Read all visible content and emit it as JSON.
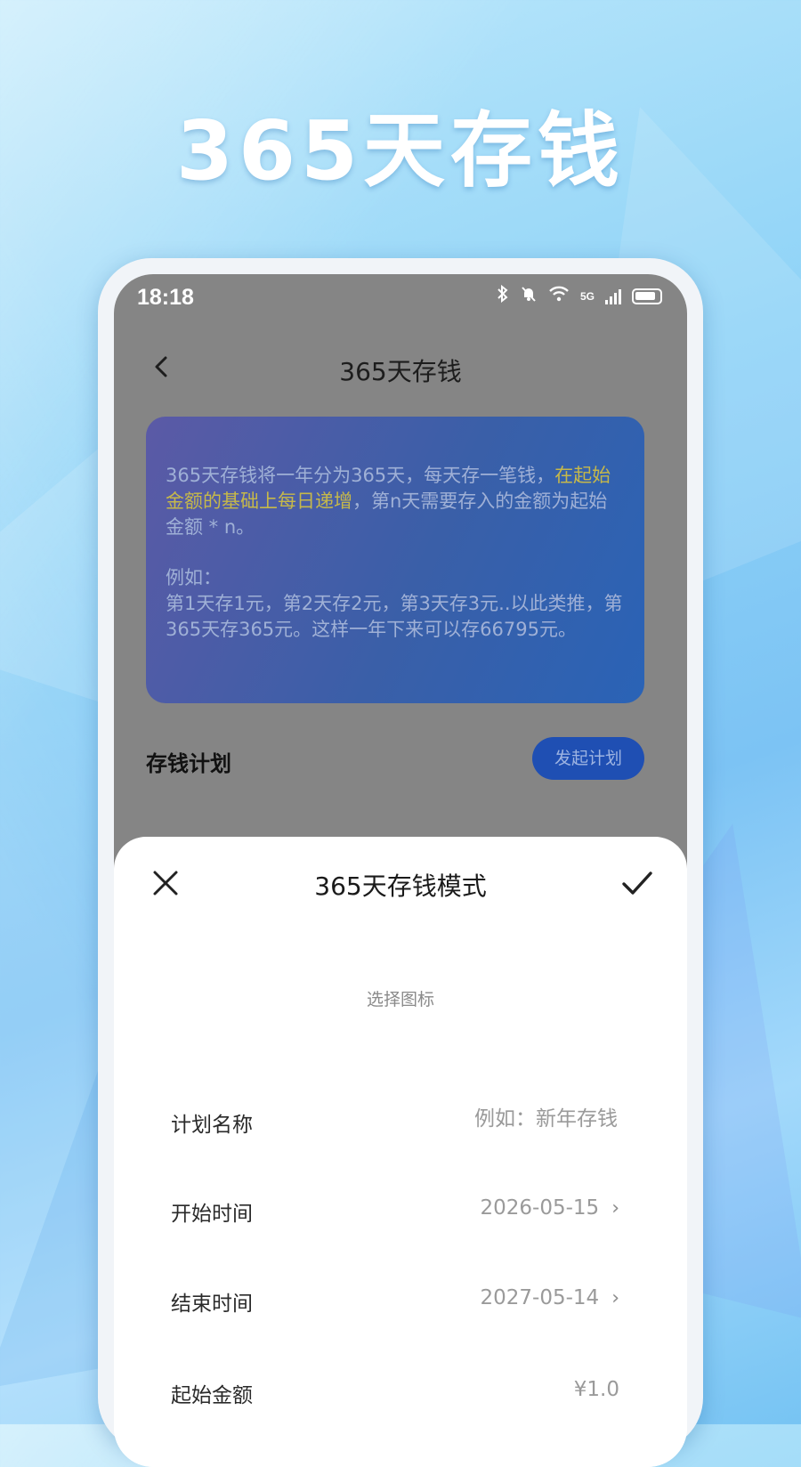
{
  "promo": {
    "title": "365天存钱"
  },
  "status_bar": {
    "time": "18:18",
    "network": "5G"
  },
  "nav": {
    "title": "365天存钱",
    "back_icon": "chevron-left-icon"
  },
  "info_card": {
    "line1": "365天存钱将一年分为365天，每天存一笔钱，",
    "highlight": "在起始金额的基础上每日递增",
    "line2_rest": "，第n天需要存入的金额为起始金额 * n。",
    "example_label": "例如：",
    "example_text": "第1天存1元，第2天存2元，第3天存3元..以此类推，第365天存365元。这样一年下来可以存66795元。"
  },
  "plan": {
    "title": "存钱计划",
    "start_button": "发起计划"
  },
  "sheet": {
    "title": "365天存钱模式",
    "choose_icon": "选择图标",
    "fields": {
      "name_label": "计划名称",
      "name_placeholder": "例如：新年存钱",
      "start_label": "开始时间",
      "start_value": "2026-05-15",
      "end_label": "结束时间",
      "end_value": "2027-05-14",
      "amount_label": "起始金额",
      "amount_value": "¥1.0"
    }
  },
  "colors": {
    "card_gradient_start": "#5b5aa6",
    "card_gradient_end": "#2a63b6",
    "highlight_text": "#c6b84a",
    "start_button_bg": "#1f4fb3"
  }
}
